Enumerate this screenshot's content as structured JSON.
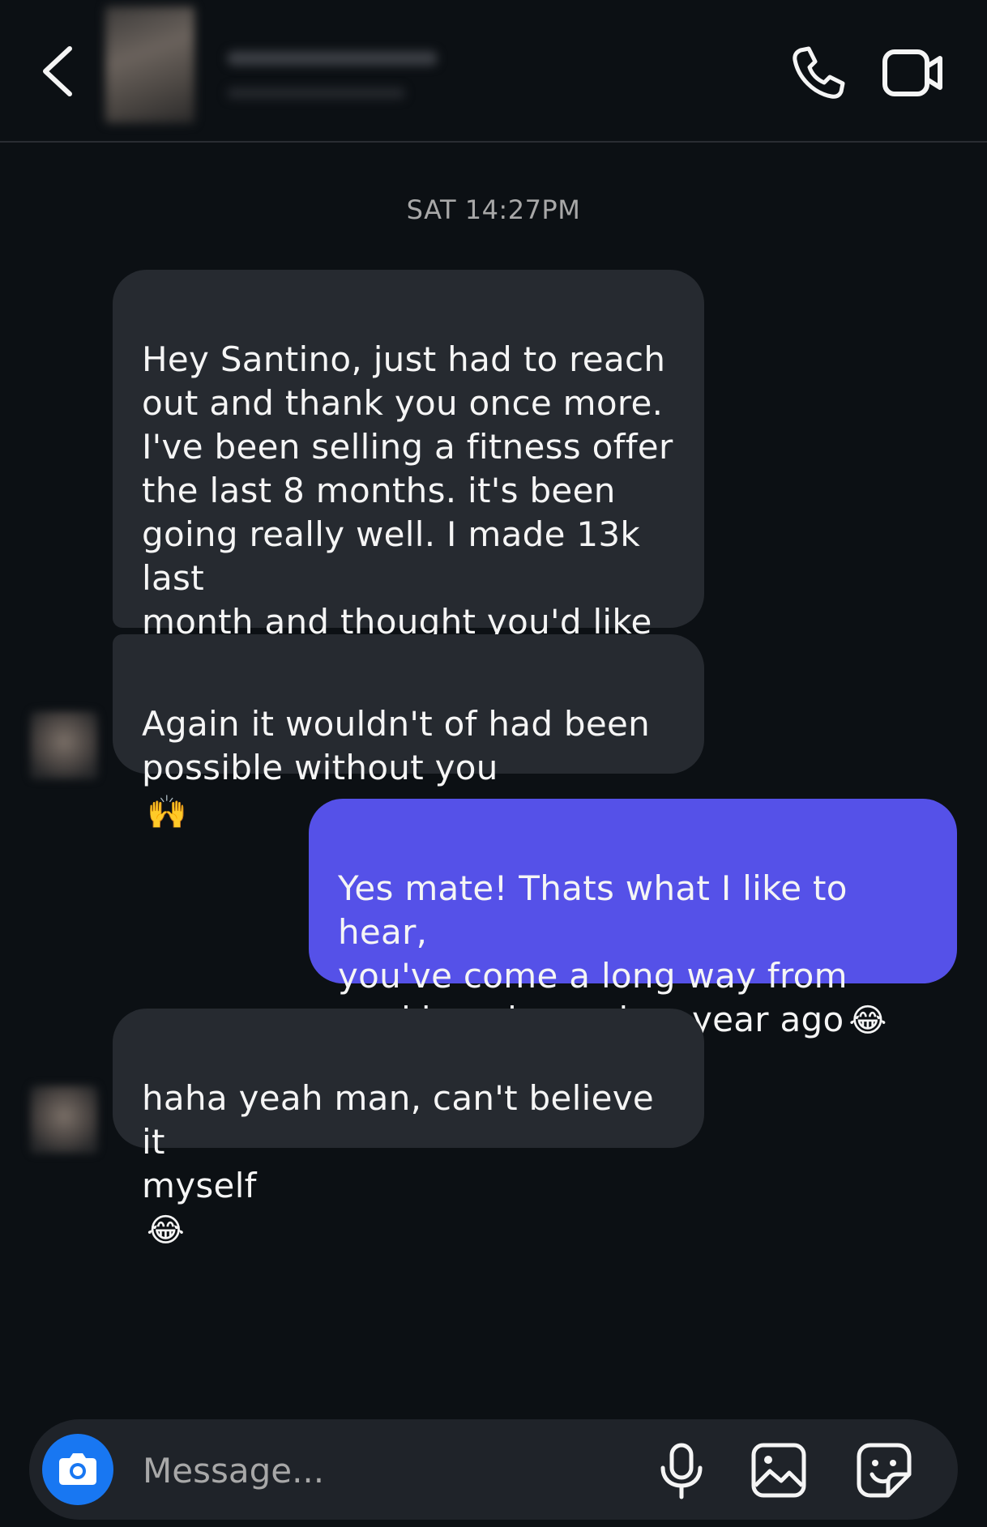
{
  "header": {
    "back_icon": "chevron-left-icon",
    "call_icon": "phone-icon",
    "video_icon": "video-camera-icon"
  },
  "thread": {
    "timestamp": "SAT 14:27PM",
    "messages": [
      {
        "direction": "incoming",
        "text": "Hey Santino, just had to reach\nout and thank you once more.\nI've been selling a fitness offer\nthe last 8 months. it's been\ngoing really well. I made 13k last\nmonth and thought you'd like to\nknow that.",
        "emoji": ""
      },
      {
        "direction": "incoming",
        "text": "Again it wouldn't of had been\npossible without you",
        "emoji": "🙌"
      },
      {
        "direction": "outgoing",
        "text": "Yes mate! Thats what I like to hear,\nyou've come a long way from\nworking uber only a year ago",
        "emoji": "😂"
      },
      {
        "direction": "incoming",
        "text": "haha yeah man, can't believe it\nmyself",
        "emoji": "😂"
      }
    ]
  },
  "composer": {
    "placeholder": "Message...",
    "camera_icon": "camera-icon",
    "mic_icon": "microphone-icon",
    "gallery_icon": "image-gallery-icon",
    "sticker_icon": "sticker-icon"
  },
  "colors": {
    "background": "#0c1014",
    "incoming_bubble": "#262a30",
    "outgoing_bubble": "#5551e8",
    "camera_button": "#1877f2"
  }
}
